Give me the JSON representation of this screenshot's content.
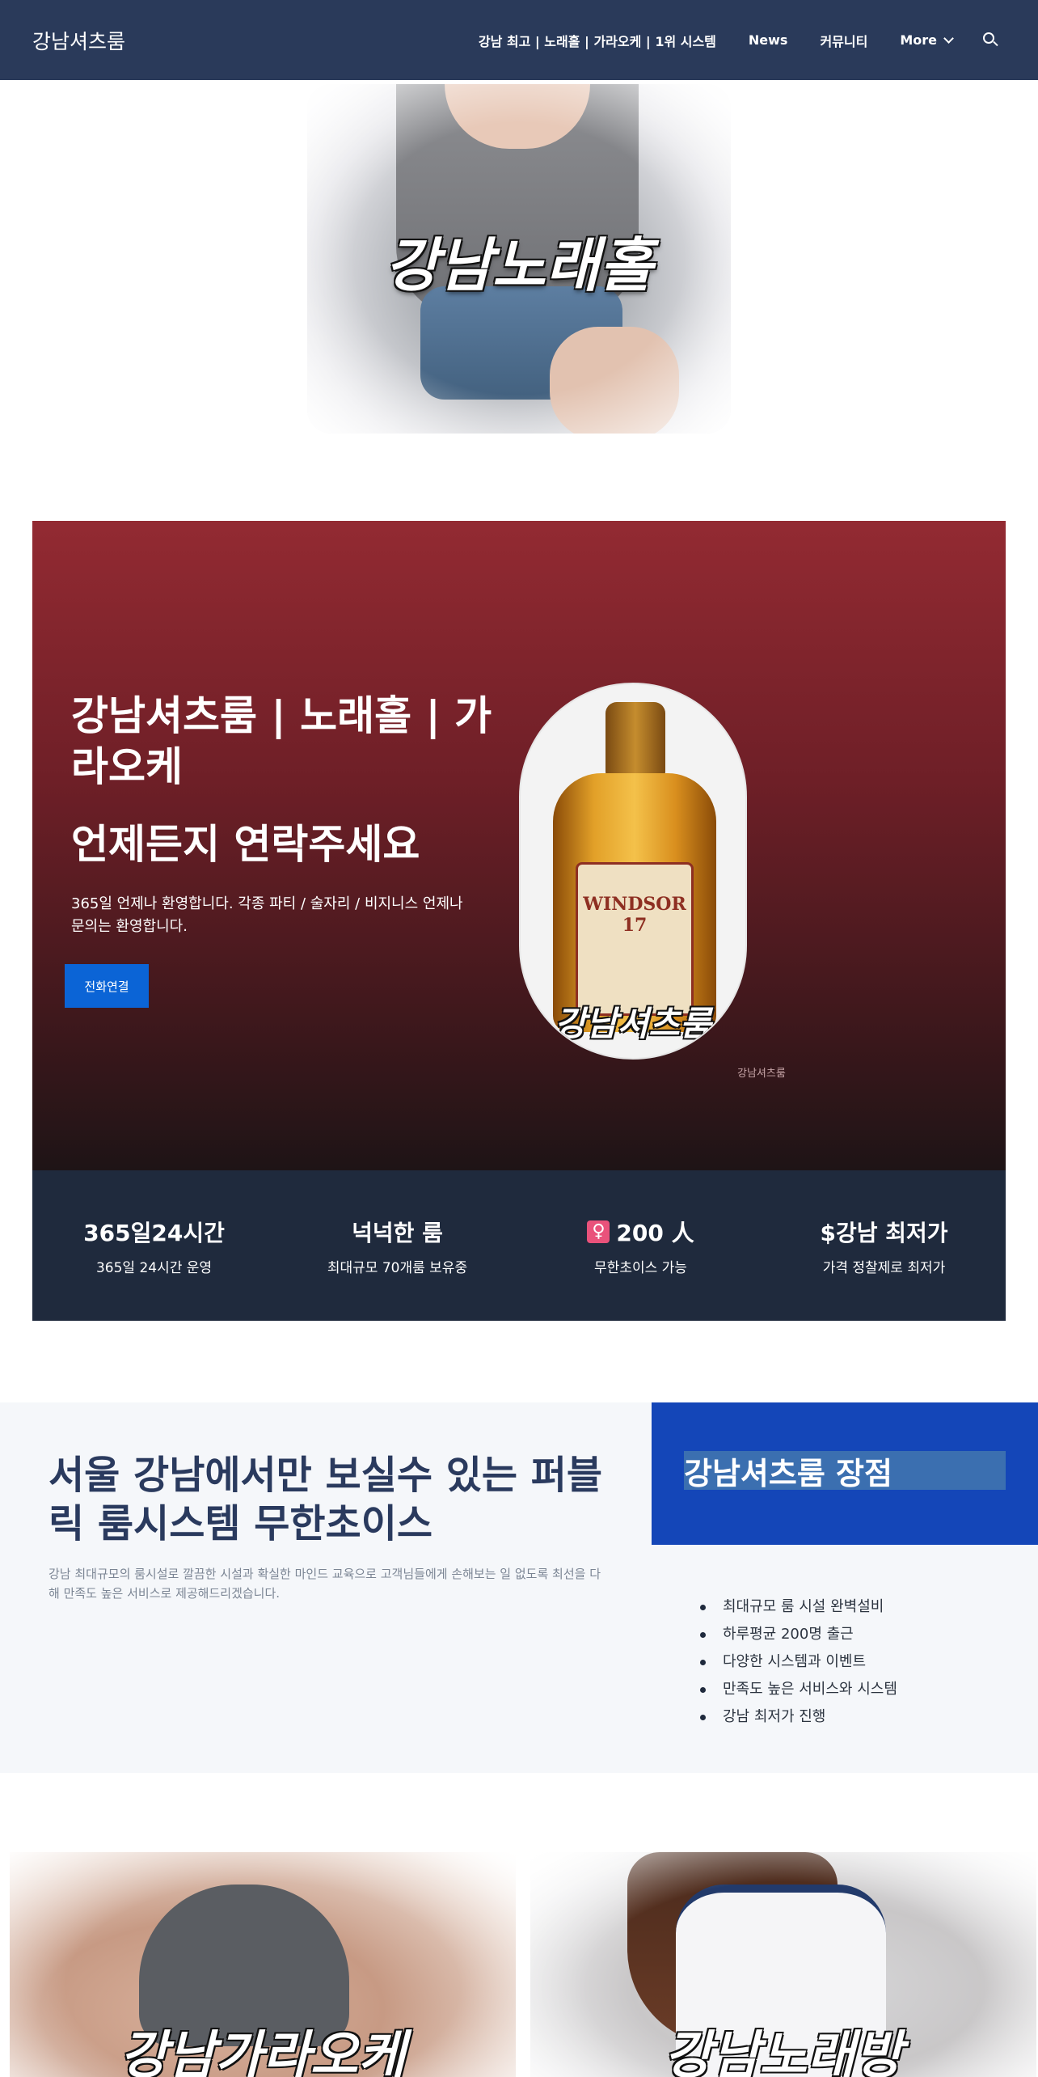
{
  "header": {
    "brand": "강남셔츠룸",
    "nav": [
      {
        "label": "강남 최고 | 노래홀 | 가라오케 | 1위 시스템"
      },
      {
        "label": "News"
      },
      {
        "label": "커뮤니티"
      },
      {
        "label": "More"
      }
    ],
    "search_icon": "search-icon"
  },
  "hero": {
    "title": "강남노래홀"
  },
  "promo": {
    "heading": "강남셔츠룸 | 노래홀 | 가라오케",
    "subheading": "언제든지 연락주세요",
    "text": "365일 언제나 환영합니다. 각종 파티 / 술자리 / 비지니스 언제나 문의는 환영합니다.",
    "button": "전화연결",
    "bottle_label": "WINDSOR 17",
    "bottle_caption": "강남셔츠룸",
    "image_credit": "강남셔츠룸"
  },
  "features": [
    {
      "title": "365일24시간",
      "sub": "365일 24시간 운영",
      "icon": ""
    },
    {
      "title": "넉넉한 룸",
      "sub": "최대규모 70개룸 보유중",
      "icon": ""
    },
    {
      "title": "200 人",
      "sub": "무한초이스 가능",
      "icon": "♀"
    },
    {
      "title": "$강남 최저가",
      "sub": "가격 정찰제로 최저가",
      "icon": ""
    }
  ],
  "strength": {
    "heading": "서울 강남에서만 보실수 있는 퍼블릭 룸시스템 무한초이스",
    "text": "강남 최대규모의 룸시설로 깔끔한 시설과 확실한 마인드 교육으로 고객님들에게 손해보는 일 없도록 최선을 다해 만족도 높은 서비스로 제공해드리겠습니다.",
    "box_title": "강남셔츠룸 장점",
    "items": [
      "최대규모 룸 시설 완벽설비",
      "하루평균 200명 출근",
      "다양한 시스템과 이벤트",
      "만족도 높은 서비스와 시스템",
      "강남 최저가 진행"
    ]
  },
  "gallery": [
    {
      "caption": "강남가라오케"
    },
    {
      "caption": "강남노래방"
    }
  ],
  "colors": {
    "header_bg": "#2a3a5a",
    "promo_top": "#932a32",
    "features_bg": "#1f2a3d",
    "button_blue": "#0b64d6",
    "box_blue": "#1446b8"
  }
}
